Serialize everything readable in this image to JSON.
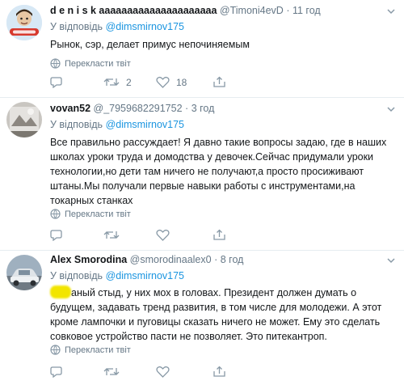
{
  "translate_label": "Перекласти твіт",
  "reply_prefix": "У відповідь",
  "tweets": [
    {
      "name": "d e n i s k aaaaaaaaaaaaaaaaaaaaa",
      "handle": "@Timoni4evD",
      "dot": "·",
      "time": "11 год",
      "reply_to": "@dimsmirnov175",
      "text": "Рынок, сэр, делает примус  непочиняемым",
      "replies": "",
      "retweets": "2",
      "likes": "18",
      "avatar_icon": "cartoon-avatar"
    },
    {
      "name": "vovan52",
      "handle": "@_7959682291752",
      "dot": "·",
      "time": "3 год",
      "reply_to": "@dimsmirnov175",
      "text": "Все правильно рассуждает! Я давно такие вопросы задаю, где в наших школах уроки труда и домодства у девочек.Сейчас придумали уроки технологии,но дети там ничего не получают,а просто просиживают штаны.Мы получали первые навыки работы с инструментами,на токарных станках",
      "replies": "",
      "retweets": "",
      "likes": "",
      "avatar_icon": "photo-avatar"
    },
    {
      "name": "Alex Smorodina",
      "handle": "@smorodinaalex0",
      "dot": "·",
      "time": "8 год",
      "reply_to": "@dimsmirnov175",
      "text": "...аный стыд, у них мох в головах. Президент должен думать о будущем, задавать тренд развития, в том числе для молодежи. А этот кроме лампочки и пуговицы сказать ничего не может. Ему это сделать совковое устройство пасти не позволяет. Это питекантроп.",
      "text_visible": "аный стыд, у них мох в головах. Президент должен думать о будущем, задавать тренд развития, в том числе для молодежи. А этот кроме лампочки и пуговицы сказать ничего не может. Ему это сделать совковое устройство пасти не позволяет. Это питекантроп.",
      "replies": "",
      "retweets": "",
      "likes": "",
      "avatar_icon": "car-photo-avatar"
    }
  ],
  "colors": {
    "link": "#1b95e0",
    "muted": "#657786",
    "text": "#14171a",
    "divider": "#e6ecf0",
    "highlight": "#f2e500"
  }
}
